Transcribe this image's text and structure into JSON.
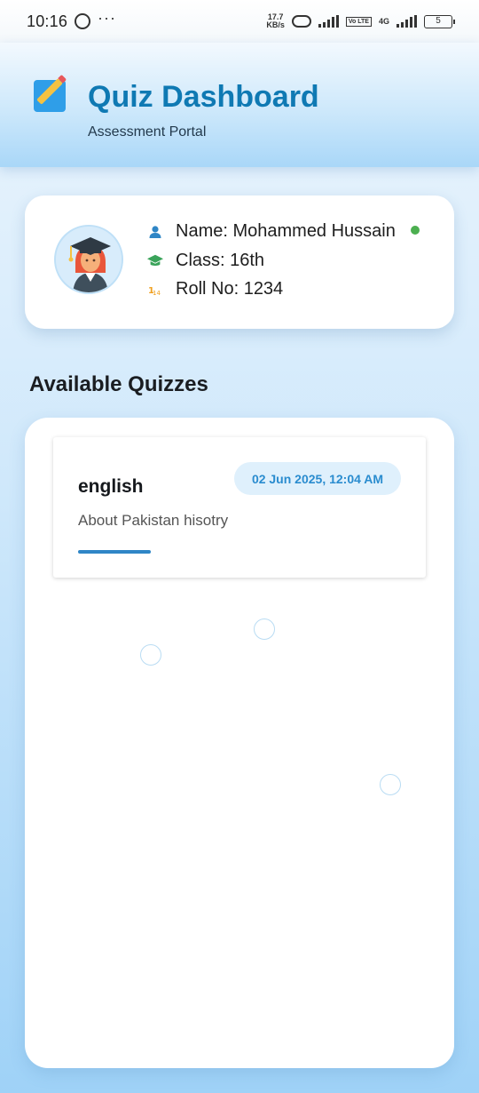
{
  "status_bar": {
    "time": "10:16",
    "more": "···",
    "speed_value": "17.7",
    "speed_unit": "KB/s",
    "volte": "Vo LTE",
    "network": "4G",
    "battery": "5"
  },
  "header": {
    "icon": "memo-pencil-icon",
    "title": "Quiz Dashboard",
    "subtitle": "Assessment Portal"
  },
  "profile": {
    "name_line": "Name: Mohammed Hussain",
    "class_line": "Class: 16th",
    "roll_line": "Roll No: 1234",
    "online_color": "#4caf50"
  },
  "quizzes": {
    "section_title": "Available Quizzes",
    "items": [
      {
        "title": "english",
        "date": "02 Jun 2025, 12:04 AM",
        "description": "About Pakistan hisotry"
      }
    ]
  },
  "colors": {
    "accent": "#0f79b3",
    "date_badge_bg": "#dff0fc",
    "date_badge_text": "#2a8ccf"
  }
}
